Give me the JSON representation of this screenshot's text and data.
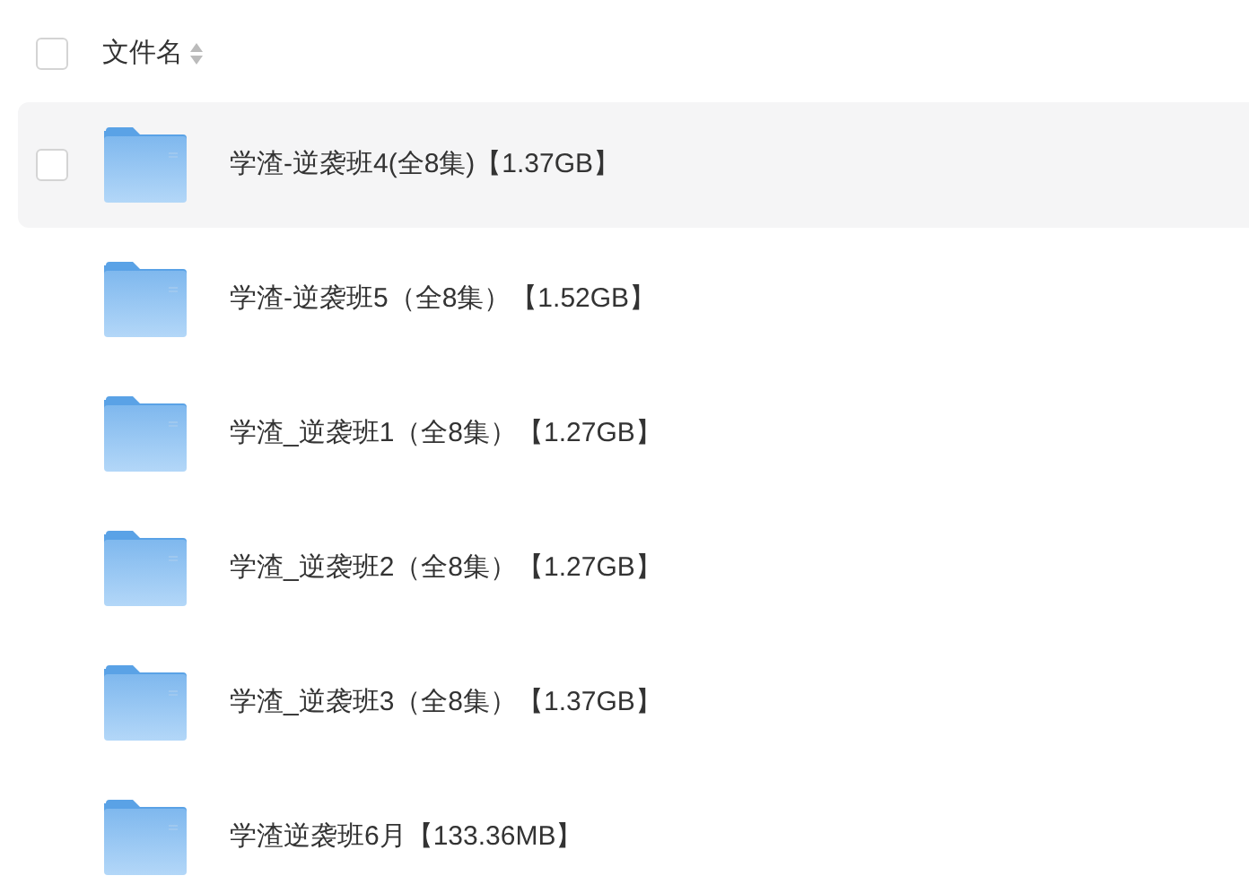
{
  "header": {
    "label": "文件名",
    "checked": false
  },
  "files": [
    {
      "name": "学渣-逆袭班4(全8集)【1.37GB】",
      "hovered": true,
      "checked": false
    },
    {
      "name": "学渣-逆袭班5（全8集）【1.52GB】",
      "hovered": false,
      "checked": false
    },
    {
      "name": "学渣_逆袭班1（全8集）【1.27GB】",
      "hovered": false,
      "checked": false
    },
    {
      "name": "学渣_逆袭班2（全8集）【1.27GB】",
      "hovered": false,
      "checked": false
    },
    {
      "name": "学渣_逆袭班3（全8集）【1.37GB】",
      "hovered": false,
      "checked": false
    },
    {
      "name": "学渣逆袭班6月【133.36MB】",
      "hovered": false,
      "checked": false
    }
  ]
}
